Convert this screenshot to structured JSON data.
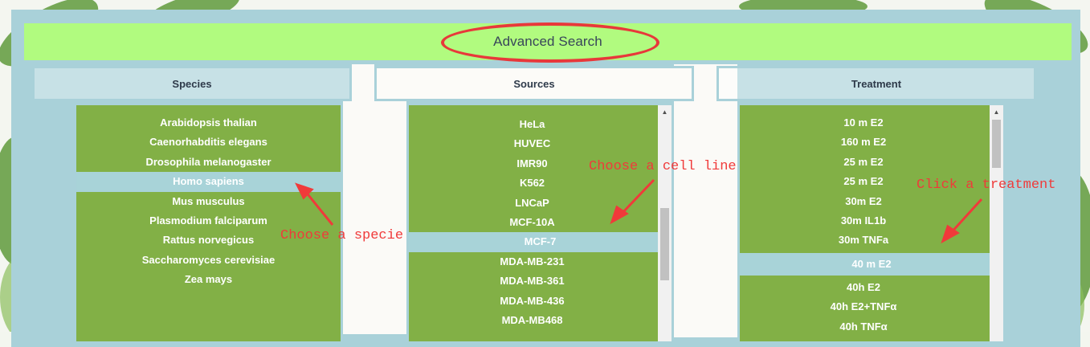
{
  "header": {
    "title": "Advanced Search"
  },
  "columns": {
    "species": {
      "label": "Species",
      "items": [
        "Arabidopsis thalian",
        "Caenorhabditis elegans",
        "Drosophila melanogaster",
        "Homo sapiens",
        "Mus musculus",
        "Plasmodium falciparum",
        "Rattus norvegicus",
        "Saccharomyces cerevisiae",
        "Zea mays"
      ],
      "selected": "Homo sapiens"
    },
    "sources": {
      "label": "Sources",
      "items": [
        "HeLa",
        "HUVEC",
        "IMR90",
        "K562",
        "LNCaP",
        "MCF-10A",
        "MCF-7",
        "MDA-MB-231",
        "MDA-MB-361",
        "MDA-MB-436",
        "MDA-MB468"
      ],
      "selected": "MCF-7"
    },
    "treatment": {
      "label": "Treatment",
      "items": [
        "10 m E2",
        "160 m E2",
        "25 m E2",
        "25 m E2",
        "30m E2",
        "30m IL1b",
        "30m TNFa",
        "40 m E2",
        "40h E2",
        "40h E2+TNFα",
        "40h TNFα"
      ],
      "selected": "40 m E2"
    }
  },
  "annotations": {
    "species": "Choose a specie",
    "sources": "Choose a cell line",
    "treatment": "Click a treatment"
  },
  "colors": {
    "header_bg": "#b1fb7f",
    "list_bg": "#82b046",
    "selected_bg": "#a8d3d8",
    "frame": "#a9d1d9",
    "annotation": "#f03a3a"
  }
}
